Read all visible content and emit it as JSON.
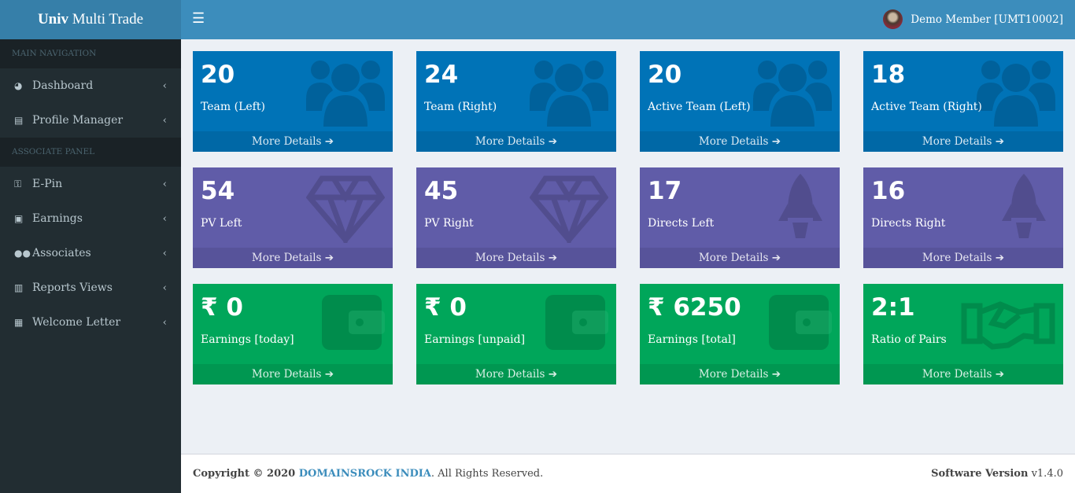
{
  "brand": {
    "bold": "Univ",
    "rest": " Multi Trade"
  },
  "header": {
    "menu_icon": "hamburger-icon",
    "user": "Demo Member [UMT10002]"
  },
  "sidebar": {
    "sections": [
      "MAIN NAVIGATION",
      "ASSOCIATE PANEL"
    ],
    "items": [
      {
        "label": "Dashboard",
        "icon": "dashboard-icon"
      },
      {
        "label": "Profile Manager",
        "icon": "id-card-icon"
      },
      {
        "label": "E-Pin",
        "icon": "key-icon"
      },
      {
        "label": "Earnings",
        "icon": "money-icon"
      },
      {
        "label": "Associates",
        "icon": "users-icon"
      },
      {
        "label": "Reports Views",
        "icon": "bar-chart-icon"
      },
      {
        "label": "Welcome Letter",
        "icon": "newspaper-icon"
      }
    ]
  },
  "boxes": [
    {
      "value": "20",
      "label": "Team (Left)",
      "icon": "users-icon"
    },
    {
      "value": "24",
      "label": "Team (Right)",
      "icon": "users-icon"
    },
    {
      "value": "20",
      "label": "Active Team (Left)",
      "icon": "users-icon"
    },
    {
      "value": "18",
      "label": "Active Team (Right)",
      "icon": "users-icon"
    },
    {
      "value": "54",
      "label": "PV Left",
      "icon": "diamond-icon"
    },
    {
      "value": "45",
      "label": "PV Right",
      "icon": "diamond-icon"
    },
    {
      "value": "17",
      "label": "Directs Left",
      "icon": "rocket-icon"
    },
    {
      "value": "16",
      "label": "Directs Right",
      "icon": "rocket-icon"
    },
    {
      "value": "₹ 0",
      "label": "Earnings [today]",
      "icon": "wallet-icon"
    },
    {
      "value": "₹ 0",
      "label": "Earnings [unpaid]",
      "icon": "wallet-icon"
    },
    {
      "value": "₹ 6250",
      "label": "Earnings [total]",
      "icon": "wallet-icon"
    },
    {
      "value": "2:1",
      "label": "Ratio of Pairs",
      "icon": "handshake-icon"
    }
  ],
  "more_label": "More Details",
  "footer": {
    "copyright": "Copyright © 2020 ",
    "company": "DOMAINSROCK INDIA",
    "rights": ". All Rights Reserved.",
    "version_label": "Software Version",
    "version": " v1.4.0"
  }
}
